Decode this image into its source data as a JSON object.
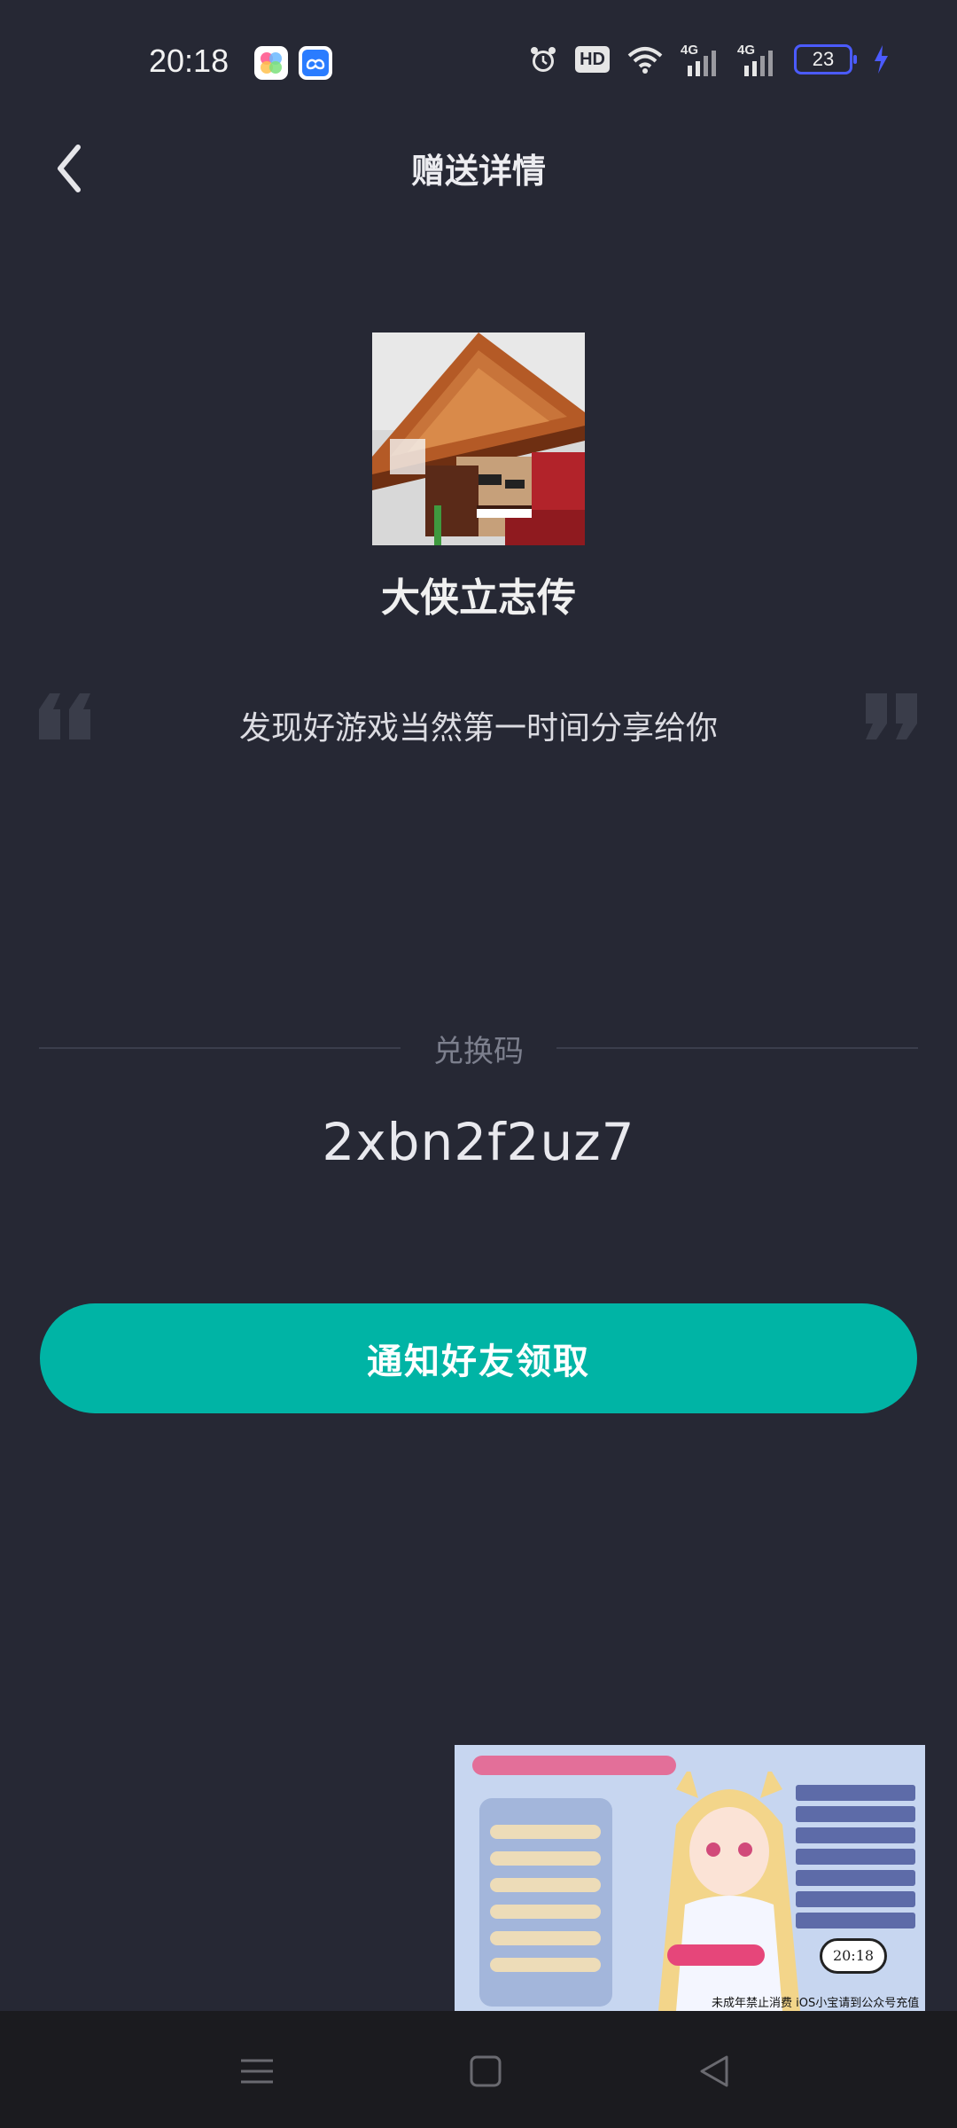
{
  "status_bar": {
    "time": "20:18",
    "hd_label": "HD",
    "network_1": "4G",
    "network_2": "4G",
    "battery_level": "23",
    "icons": [
      "color-app-icon",
      "baidu-cloud-icon",
      "alarm-icon",
      "hd-icon",
      "wifi-icon",
      "signal-icon",
      "signal-icon",
      "battery-icon",
      "charging-icon"
    ]
  },
  "header": {
    "title": "赠送详情",
    "back_icon": "back-chevron-icon"
  },
  "game": {
    "name": "大侠立志传",
    "icon": "game-icon-pixel-hero"
  },
  "share": {
    "message": "发现好游戏当然第一时间分享给你"
  },
  "redeem": {
    "label": "兑换码",
    "code": "2xbn2f2uz7"
  },
  "actions": {
    "notify_label": "通知好友领取"
  },
  "floating_video": {
    "clock": "20:18",
    "caption": "未成年禁止消费 iOS小宝请到公众号充值"
  },
  "nav_bar": {
    "icons": [
      "menu-icon",
      "home-icon",
      "back-triangle-icon"
    ]
  },
  "colors": {
    "background": "#262834",
    "accent": "#00b4a5",
    "muted": "#7c7f8d",
    "battery": "#4b5bff"
  }
}
